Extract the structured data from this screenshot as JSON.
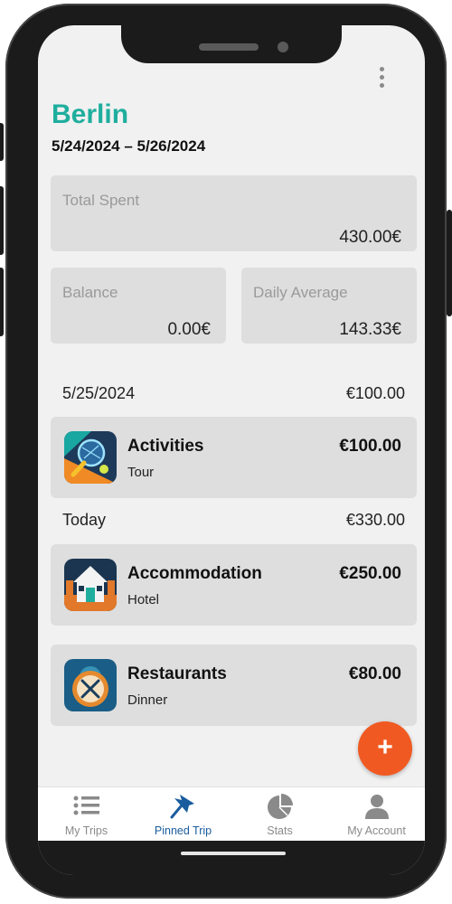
{
  "trip": {
    "title": "Berlin",
    "dates": "5/24/2024 – 5/26/2024"
  },
  "summary": {
    "total_spent_label": "Total Spent",
    "total_spent_value": "430.00€",
    "balance_label": "Balance",
    "balance_value": "0.00€",
    "daily_average_label": "Daily Average",
    "daily_average_value": "143.33€"
  },
  "days": [
    {
      "date": "5/25/2024",
      "total": "€100.00",
      "expenses": [
        {
          "category": "Activities",
          "description": "Tour",
          "amount": "€100.00",
          "icon": "activities-icon"
        }
      ]
    },
    {
      "date": "Today",
      "total": "€330.00",
      "expenses": [
        {
          "category": "Accommodation",
          "description": "Hotel",
          "amount": "€250.00",
          "icon": "accommodation-icon"
        },
        {
          "category": "Restaurants",
          "description": "Dinner",
          "amount": "€80.00",
          "icon": "restaurants-icon"
        }
      ]
    }
  ],
  "fab": {
    "symbol": "+"
  },
  "nav": [
    {
      "label": "My Trips",
      "icon": "list-icon",
      "active": false
    },
    {
      "label": "Pinned Trip",
      "icon": "pin-icon",
      "active": true
    },
    {
      "label": "Stats",
      "icon": "pie-chart-icon",
      "active": false
    },
    {
      "label": "My Account",
      "icon": "person-icon",
      "active": false
    }
  ],
  "colors": {
    "accent": "#1fae9e",
    "fab": "#f05a22",
    "active_nav": "#1a5c9e",
    "card_bg": "#dedede",
    "screen_bg": "#f1f1f1"
  }
}
